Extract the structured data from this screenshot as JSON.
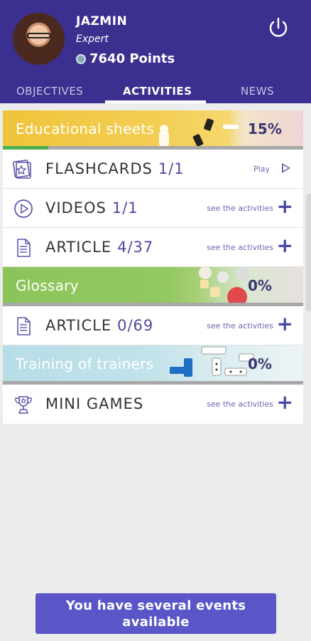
{
  "user": {
    "name": "JAZMIN",
    "level": "Expert",
    "points": "7640 Points"
  },
  "tabs": [
    {
      "label": "OBJECTIVES",
      "active": false
    },
    {
      "label": "ACTIVITIES",
      "active": true
    },
    {
      "label": "NEWS",
      "active": false
    }
  ],
  "sections": [
    {
      "title": "Educational sheets",
      "percent": "15%",
      "progress": 0.15,
      "color": "#f0c43a",
      "rows": [
        {
          "label": "FLASHCARDS",
          "count": "1/1",
          "action": "Play",
          "icon": "flashcard-icon"
        },
        {
          "label": "VIDEOS",
          "count": "1/1",
          "action": "see the activities",
          "icon": "play-circle-icon"
        },
        {
          "label": "ARTICLE",
          "count": "4/37",
          "action": "see the activities",
          "icon": "document-icon"
        }
      ]
    },
    {
      "title": "Glossary",
      "percent": "0%",
      "progress": 0,
      "color": "#8cc45a",
      "rows": [
        {
          "label": "ARTICLE",
          "count": "0/69",
          "action": "see the activities",
          "icon": "document-icon"
        }
      ]
    },
    {
      "title": "Training of trainers",
      "percent": "0%",
      "progress": 0,
      "color": "#b7dde6",
      "rows": [
        {
          "label": "MINI GAMES",
          "count": "",
          "action": "see the activities",
          "icon": "trophy-icon"
        }
      ]
    }
  ],
  "events_button": {
    "line1": "You have several events",
    "line2": "available"
  },
  "colors": {
    "header": "#3b2f8f",
    "accent": "#5b56c8",
    "progress": "#4caf50"
  }
}
